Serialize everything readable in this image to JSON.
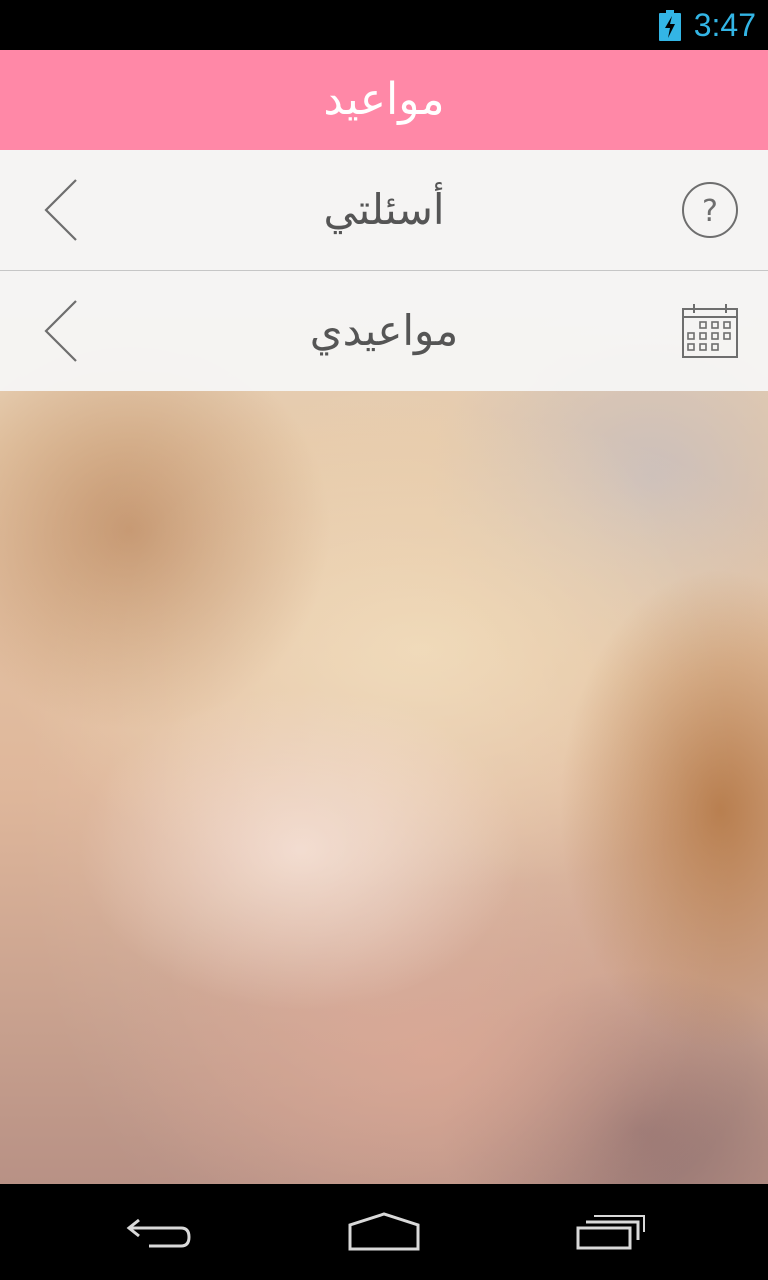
{
  "status_bar": {
    "time": "3:47",
    "battery_icon": "battery-charging-icon",
    "accent_color": "#33b5e5"
  },
  "action_bar": {
    "title": "مواعيد",
    "color": "#ff88a7"
  },
  "menu": {
    "items": [
      {
        "label": "أسئلتي",
        "icon": "question-circle-icon",
        "chevron": "chevron-left-icon"
      },
      {
        "label": "مواعيدي",
        "icon": "calendar-icon",
        "chevron": "chevron-left-icon"
      }
    ]
  },
  "nav_bar": {
    "back_icon": "back-icon",
    "home_icon": "home-icon",
    "recent_icon": "recent-apps-icon"
  }
}
